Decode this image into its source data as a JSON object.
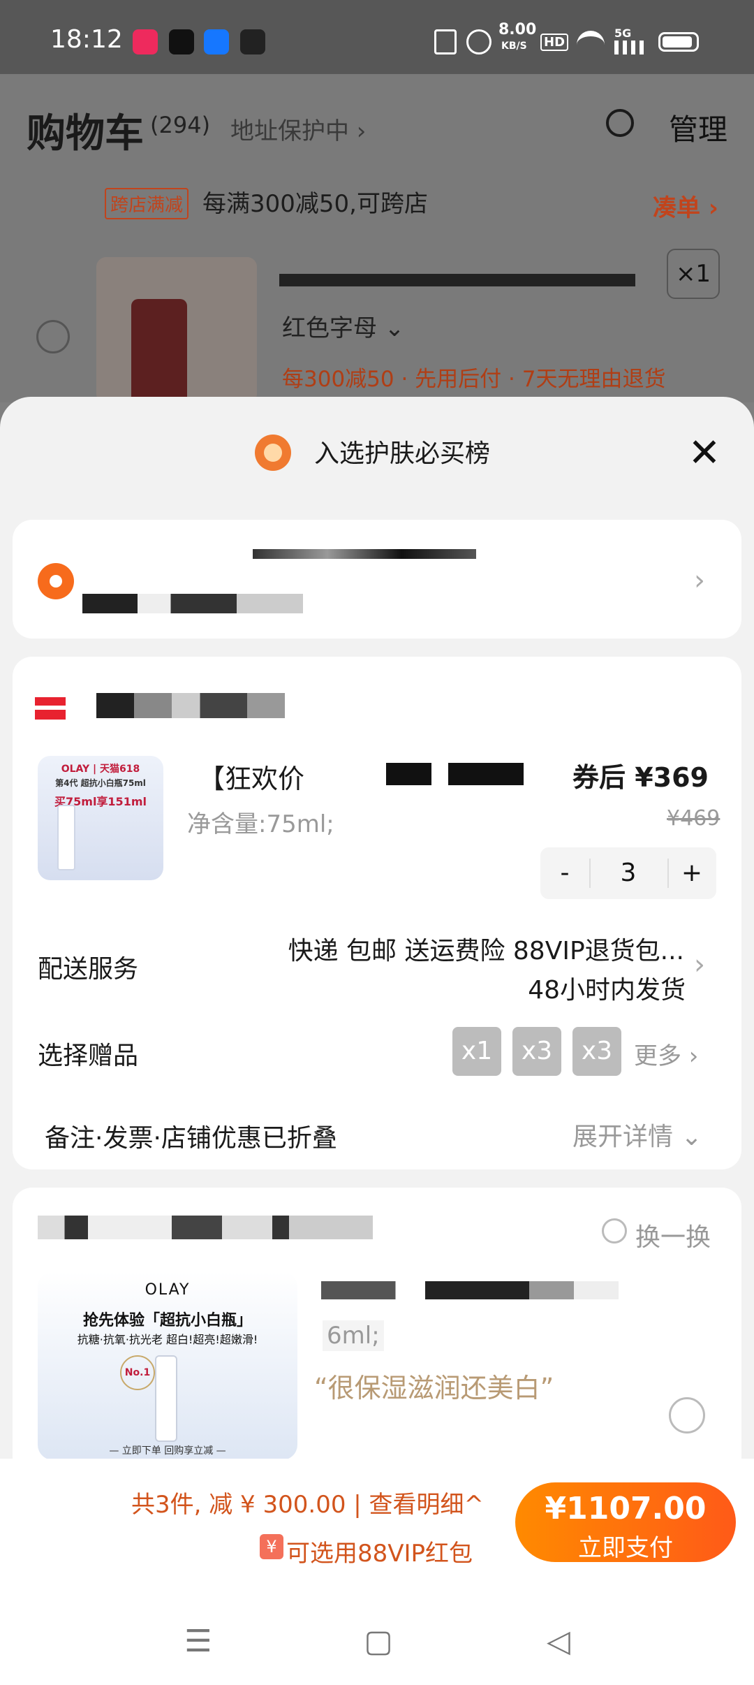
{
  "status_bar": {
    "time": "18:12",
    "speed": "8.00",
    "speed_unit": "KB/S",
    "hd": "HD",
    "network": "5G"
  },
  "cart": {
    "title": "购物车",
    "count": "(294)",
    "address_protect": "地址保护中 ›",
    "manage": "管理",
    "promo_tag": "跨店满减",
    "promo_text": "每满300减50,可跨店",
    "couner": "凑单 ›",
    "qty": "×1",
    "variant": "红色字母 ⌄",
    "service": "每300减50 · 先用后付 · 7天无理由退货"
  },
  "sheet": {
    "title": "入选护肤必买榜",
    "close": "✕"
  },
  "product": {
    "title": "【狂欢价",
    "spec": "净含量:75ml;",
    "price": "券后 ¥369",
    "old_price": "¥469",
    "qty": "3",
    "minus": "-",
    "plus": "+",
    "img_line1": "OLAY | 天猫618",
    "img_line2": "第4代 超抗小白瓶75ml",
    "img_line3": "买75ml享151ml"
  },
  "delivery": {
    "label": "配送服务",
    "line1": "快递 包邮 送运费险 88VIP退货包...",
    "line2": "48小时内发货"
  },
  "gifts": {
    "label": "选择赠品",
    "items": [
      "x1",
      "x3",
      "x3"
    ],
    "more": "更多 ›"
  },
  "folded": {
    "text": "备注·发票·店铺优惠已折叠",
    "expand": "展开详情 ⌄"
  },
  "recommend": {
    "swap": "换一换",
    "olay_logo": "OLAY",
    "headline": "抢先体验「超抗小白瓶」",
    "subline": "抗糖·抗氧·抗光老 超白!超亮!超嫩滑!",
    "footer": "— 立即下单 回购享立减 —",
    "badge": "No.1",
    "spec": "6ml;",
    "quote": "“很保湿滋润还美白”"
  },
  "bottom": {
    "summary": "共3件, 减 ¥ 300.00 | 查看明细^",
    "vip": "可选用88VIP红包",
    "vip_icon": "¥",
    "pay_amount": "¥1107.00",
    "pay_label": "立即支付"
  },
  "nav": {
    "menu": "☰",
    "home": "▢",
    "back": "◁"
  }
}
